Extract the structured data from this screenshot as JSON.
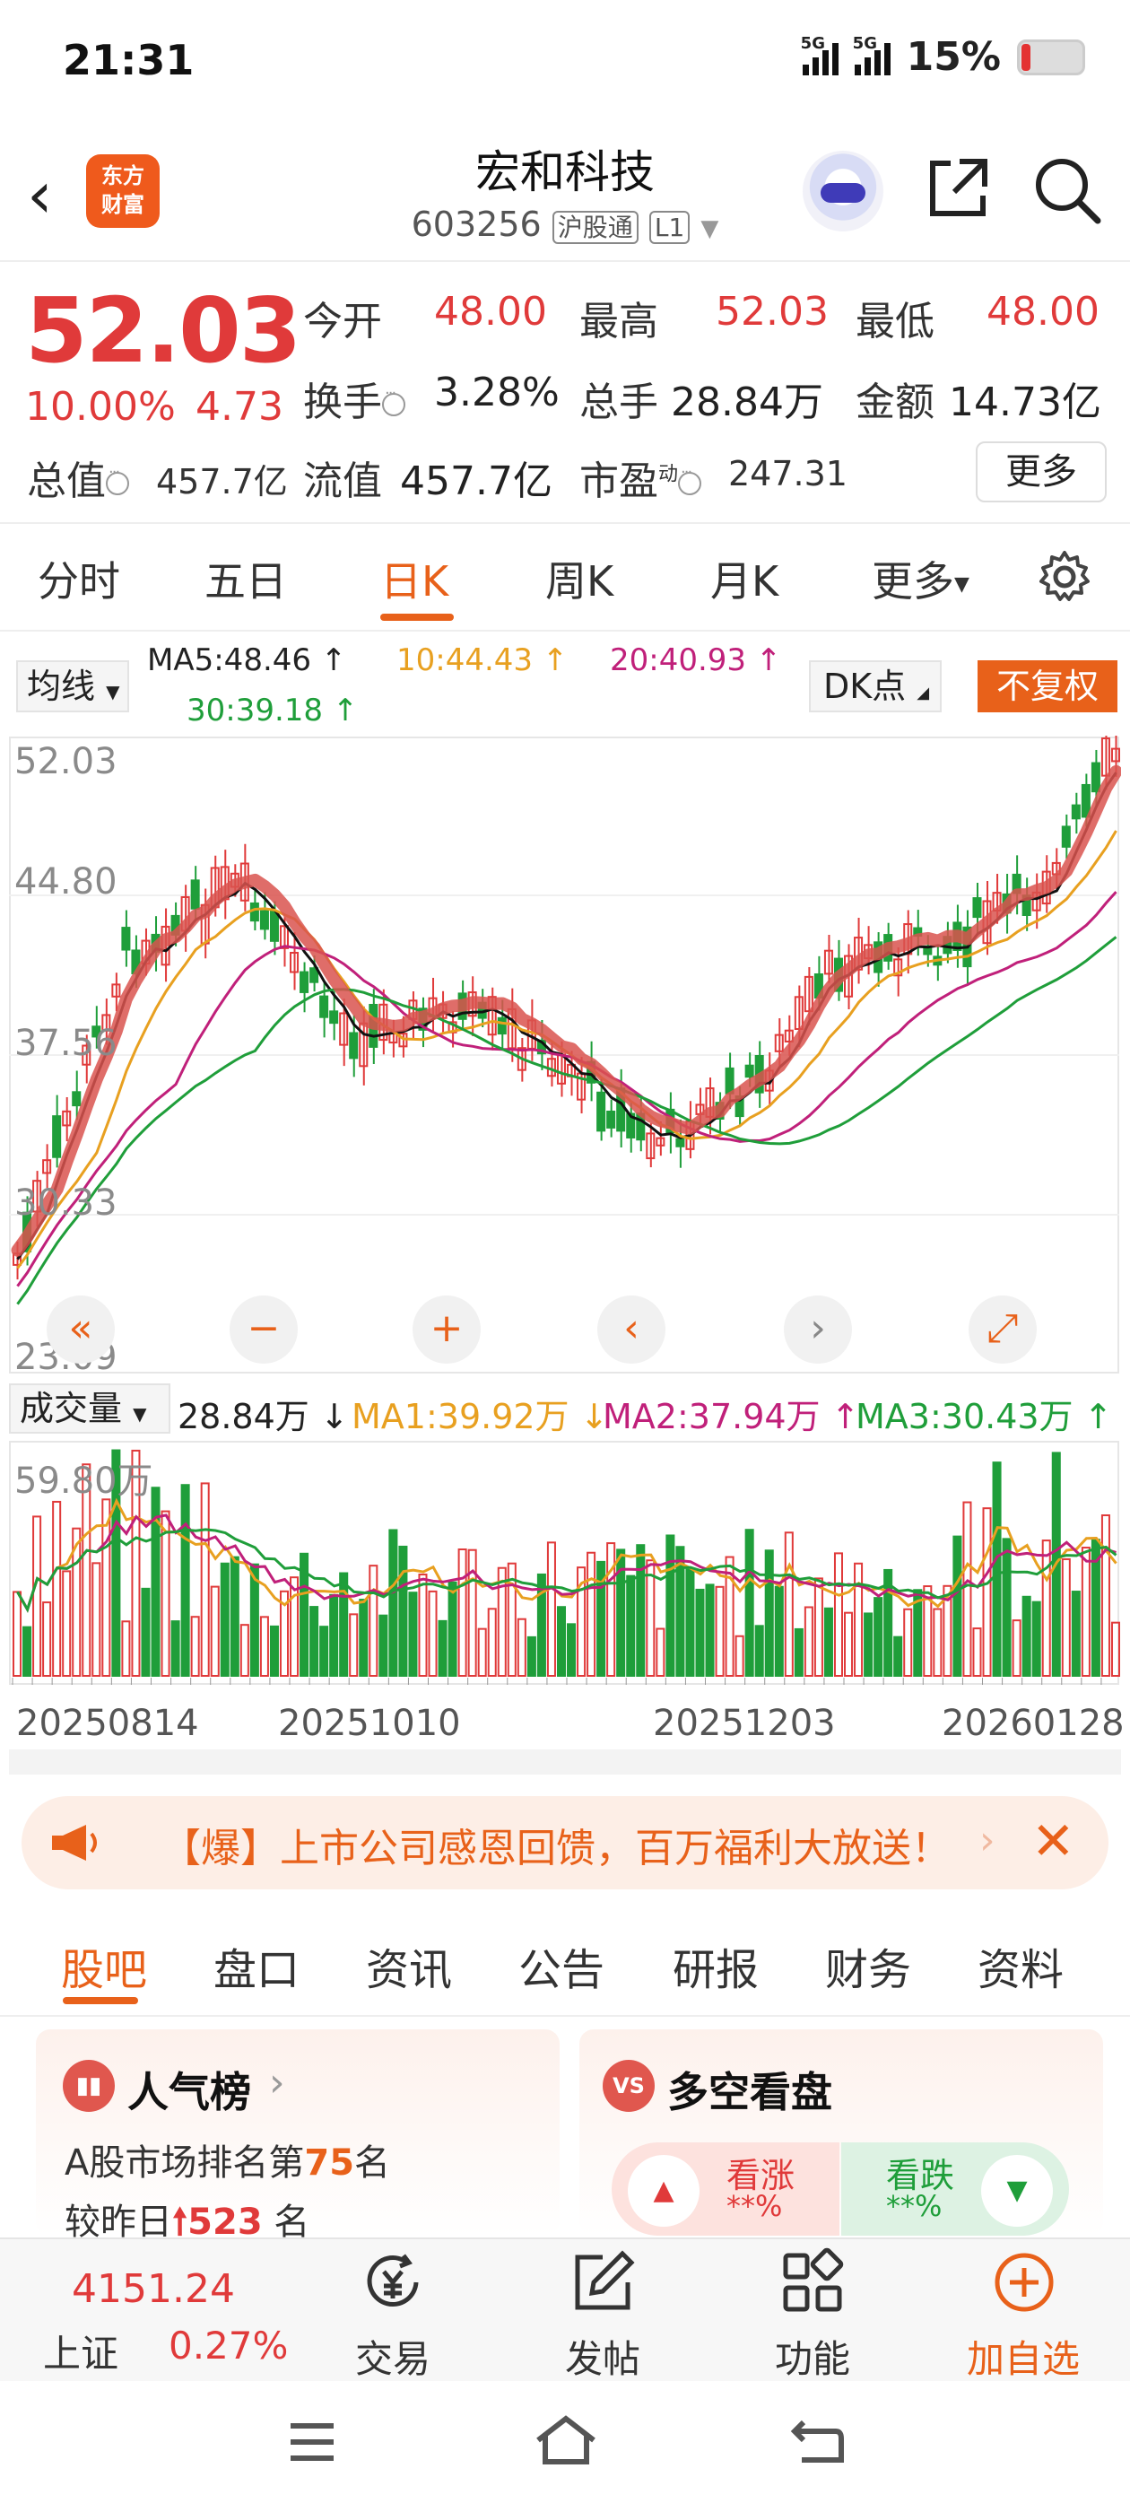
{
  "status_bar": {
    "time": "21:31",
    "network1": "5G",
    "network2": "5G",
    "battery": "15%"
  },
  "header": {
    "logo_line1": "东方",
    "logo_line2": "财富",
    "stock_name": "宏和科技",
    "stock_code": "603256",
    "tag1": "沪股通",
    "tag2": "L1"
  },
  "quote": {
    "price": "52.03",
    "change_pct": "10.00%",
    "change": "4.73",
    "open_label": "今开",
    "open": "48.00",
    "high_label": "最高",
    "high": "52.03",
    "low_label": "最低",
    "low": "48.00",
    "turnover_label": "换手",
    "turnover": "3.28%",
    "volume_label": "总手",
    "volume": "28.84万",
    "amount_label": "金额",
    "amount": "14.73亿",
    "mktcap_label": "总值",
    "mktcap": "457.7亿",
    "float_label": "流值",
    "float_cap": "457.7亿",
    "pe_label": "市盈",
    "pe_sup": "动",
    "pe": "247.31",
    "more": "更多"
  },
  "period_tabs": [
    "分时",
    "五日",
    "日K",
    "周K",
    "月K",
    "更多"
  ],
  "ma": {
    "selector": "均线",
    "ma5": "MA5:48.46 ↑",
    "ma10": "10:44.43 ↑",
    "ma20": "20:40.93 ↑",
    "ma30": "30:39.18 ↑",
    "dk": "DK点",
    "adjust": "不复权"
  },
  "chart_data": {
    "type": "candlestick",
    "y_ticks": [
      "52.03",
      "44.80",
      "37.56",
      "30.33",
      "23.09"
    ],
    "ylim": [
      23.09,
      52.03
    ],
    "x_ticks": [
      "20250814",
      "20251010",
      "20251203",
      "20260128"
    ],
    "colors": {
      "up": "#e03a3a",
      "down": "#1f9e3a",
      "ma5": "#111111",
      "ma10": "#e8a020",
      "ma20": "#c0207a",
      "ma30": "#1f9e3a",
      "annotation": "#d9534f"
    }
  },
  "volume": {
    "selector": "成交量",
    "current": "28.84万 ↓",
    "ma1": "MA1:39.92万 ↓",
    "ma2": "MA2:37.94万 ↑",
    "ma3": "MA3:30.43万 ↑",
    "max_label": "59.80万"
  },
  "banner": {
    "text": "【爆】上市公司感恩回馈，百万福利大放送！"
  },
  "content_tabs": [
    "股吧",
    "盘口",
    "资讯",
    "公告",
    "研报",
    "财务",
    "资料"
  ],
  "popularity": {
    "title": "人气榜",
    "line1_pre": "A股市场排名第",
    "rank": "75",
    "line1_post": "名",
    "line2_pre": "较昨日",
    "delta": "523",
    "line2_post": "名"
  },
  "sentiment": {
    "title": "多空看盘",
    "bull_label": "看涨",
    "bull_value": "**%",
    "bear_label": "看跌",
    "bear_value": "**%"
  },
  "bottom_bar": {
    "index_value": "4151.24",
    "index_name": "上证",
    "index_change": "0.27%",
    "trade": "交易",
    "post": "发帖",
    "features": "功能",
    "add_watch": "加自选"
  }
}
